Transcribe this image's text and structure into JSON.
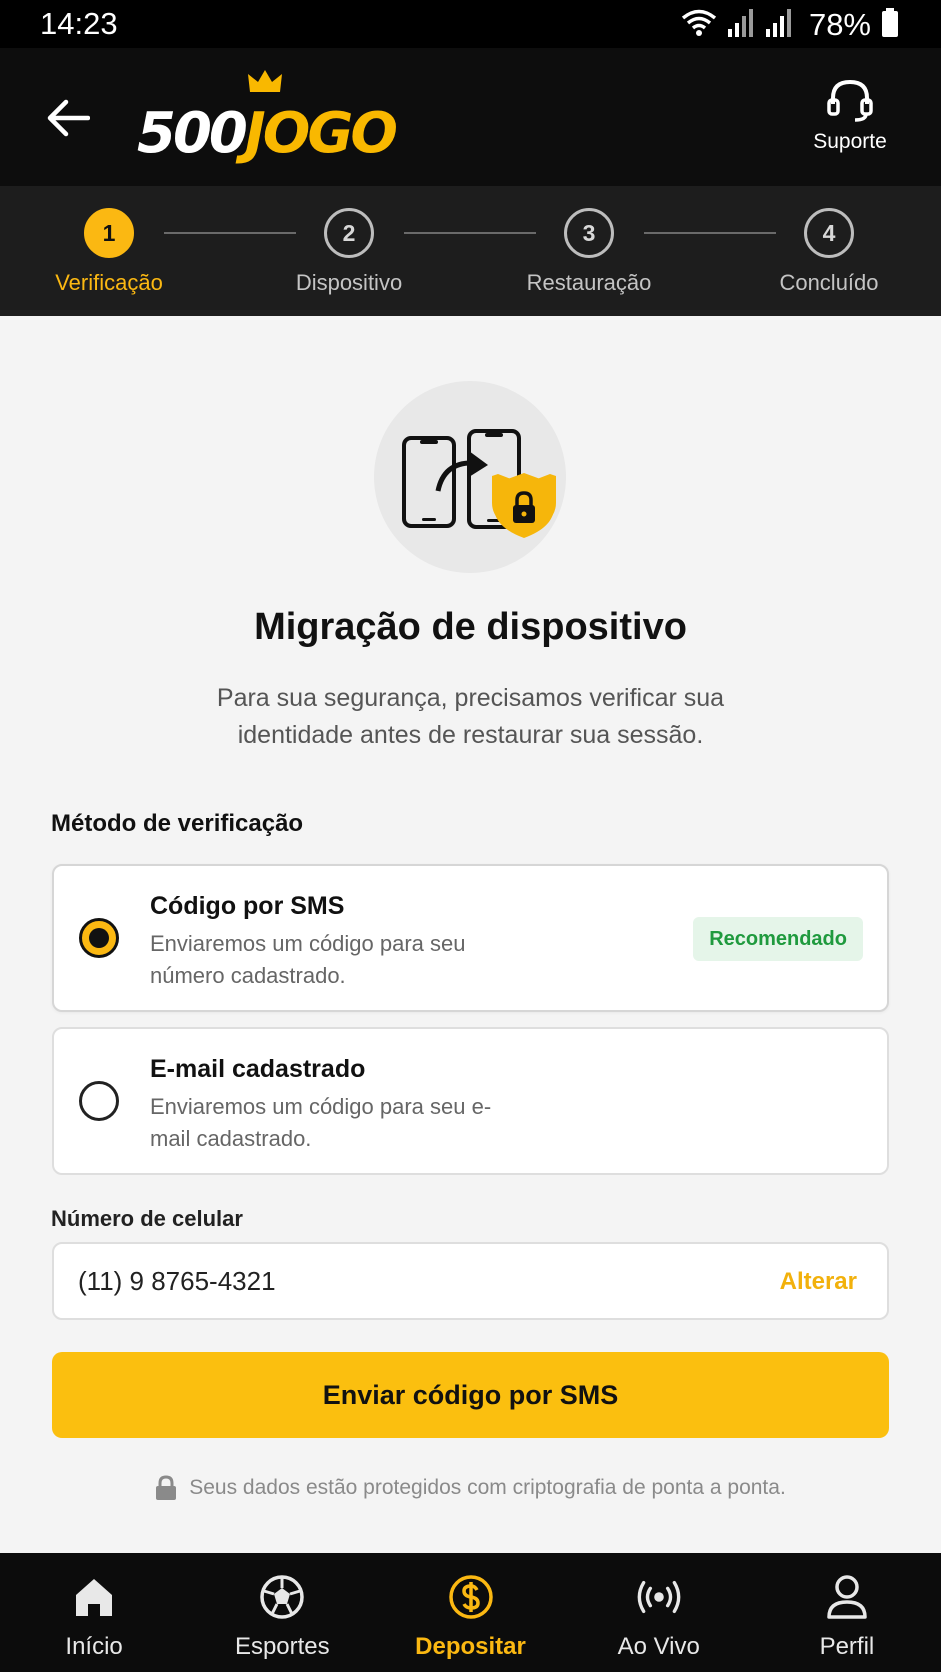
{
  "status_bar": {
    "time": "14:23",
    "battery": "78%"
  },
  "header": {
    "logo_number": "500",
    "logo_word": "JOGO",
    "support_label": "Suporte"
  },
  "stepper": {
    "steps": [
      {
        "number": "1",
        "label": "Verificação",
        "active": true
      },
      {
        "number": "2",
        "label": "Dispositivo",
        "active": false
      },
      {
        "number": "3",
        "label": "Restauração",
        "active": false
      },
      {
        "number": "4",
        "label": "Concluído",
        "active": false
      }
    ]
  },
  "main": {
    "title": "Migração de dispositivo",
    "subtitle": "Para sua segurança, precisamos verificar sua identidade antes de restaurar sua sessão.",
    "method_label": "Método de verificação",
    "options": [
      {
        "title": "Código por SMS",
        "description": "Enviaremos um código para seu número cadastrado.",
        "badge": "Recomendado",
        "selected": true
      },
      {
        "title": "E-mail cadastrado",
        "description": "Enviaremos um código para seu e-mail cadastrado.",
        "selected": false
      }
    ],
    "phone_label": "Número de celular",
    "phone_value": "(11) 9 8765-4321",
    "change_label": "Alterar",
    "send_button": "Enviar código por SMS",
    "security_note": "Seus dados estão protegidos com criptografia de ponta a ponta."
  },
  "bottom_nav": {
    "items": [
      {
        "label": "Início",
        "icon": "home-icon"
      },
      {
        "label": "Esportes",
        "icon": "soccer-ball-icon"
      },
      {
        "label": "Depositar",
        "icon": "dollar-icon",
        "active": true
      },
      {
        "label": "Ao Vivo",
        "icon": "live-broadcast-icon"
      },
      {
        "label": "Perfil",
        "icon": "user-icon"
      }
    ]
  },
  "colors": {
    "accent": "#fbb812",
    "header_bg": "#0d0d0d",
    "stepper_bg": "#1d1d1d",
    "badge_green": "#1f9a3e"
  }
}
